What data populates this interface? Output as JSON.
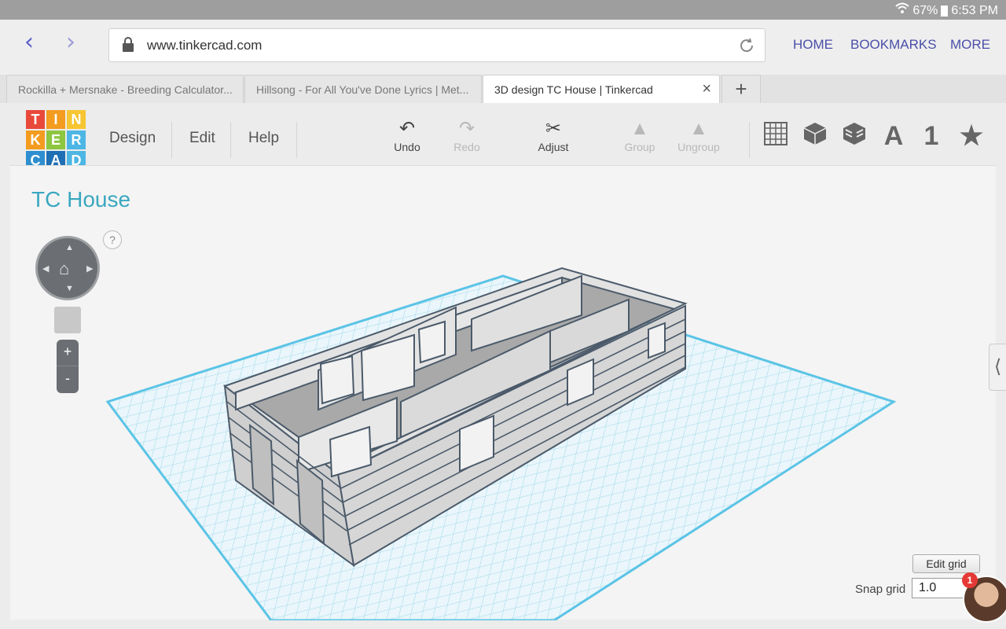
{
  "status": {
    "battery": "67%",
    "time": "6:53 PM"
  },
  "browser": {
    "url": "www.tinkercad.com",
    "links": [
      "HOME",
      "BOOKMARKS",
      "MORE"
    ],
    "tabs": [
      "Rockilla + Mersnake - Breeding Calculator...",
      "Hillsong - For All You've Done Lyrics | Met...",
      "3D design TC House | Tinkercad"
    ]
  },
  "app": {
    "logo_letters": [
      "T",
      "I",
      "N",
      "K",
      "E",
      "R",
      "C",
      "A",
      "D"
    ],
    "menu": [
      "Design",
      "Edit",
      "Help"
    ],
    "tools": {
      "undo": "Undo",
      "redo": "Redo",
      "adjust": "Adjust",
      "group": "Group",
      "ungroup": "Ungroup"
    },
    "right_tools": {
      "text": "A",
      "number": "1"
    }
  },
  "workplane": {
    "title": "TC House",
    "help": "?",
    "zoom_in": "+",
    "zoom_out": "-",
    "edit_grid": "Edit grid",
    "snap_label": "Snap grid",
    "snap_value": "1.0",
    "notification_count": "1"
  },
  "colors": {
    "accent": "#3aa7c0",
    "grid": "#5bc4e6",
    "wall": "#d6d6d6",
    "wall_edge": "#4b5a6a"
  }
}
